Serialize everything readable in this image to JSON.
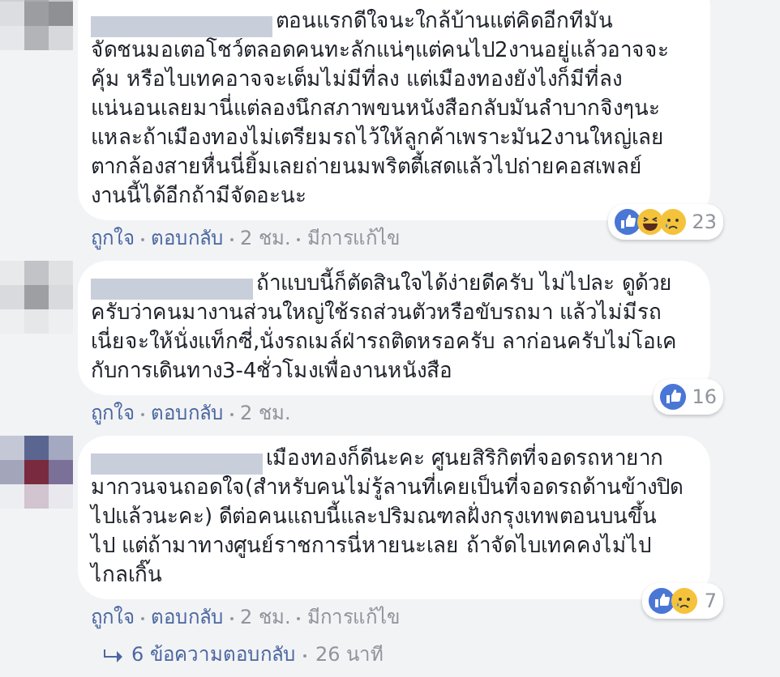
{
  "comments": [
    {
      "text": "ตอนแรกดีใจนะใกล้บ้านแต่คิดอีกทีมัน\nจัดชนมอเตอโชว์ตลอดคนทะลักแน่ๆแต่คนไป2งานอยู่แล้วอาจจะ\nคุ้ม หรือไบเทคอาจจะเต็มไม่มีที่ลง แต่เมืองทองยังไงก็มีที่ลง\nแน่นอนเลยมานี่แต่ลองนึกสภาพขนหนังสือกลับมันลำบากจิงๆนะ\nแหละถ้าเมืองทองไม่เตรียมรถไว้ให้ลูกค้าเพราะมัน2งานใหญ่เลย\nตากล้องสายหื่นนี่ยิ้มเลยถ่ายนมพริตตี้เสดแล้วไปถ่ายคอสเพลย์\nงานนี้ได้อีกถ้ามีจัดอะนะ",
      "reactions": [
        {
          "kind": "like"
        },
        {
          "kind": "haha"
        },
        {
          "kind": "sad"
        }
      ],
      "count": "23",
      "meta": [
        {
          "text": "ถูกใจ",
          "kind": "link"
        },
        {
          "text": "ตอบกลับ",
          "kind": "link"
        },
        {
          "text": "2 ชม.",
          "kind": "plain"
        },
        {
          "text": "มีการแก้ไข",
          "kind": "plain"
        }
      ]
    },
    {
      "text": "ถ้าแบบนี้ก็ตัดสินใจได้ง่ายดีครับ ไม่ไปละ ดูด้วย\nครับว่าคนมางานส่วนใหญ่ใช้รถส่วนตัวหรือขับรถมา แล้วไม่มีรถ\nเนี่ยจะให้นั่งแท็กซี่,นั่งรถเมล์ฝ่ารถติดหรอครับ ลาก่อนครับไม่โอเค\nกับการเดินทาง3-4ชั่วโมงเพื่องานหนังสือ",
      "reactions": [
        {
          "kind": "like"
        }
      ],
      "count": "16",
      "meta": [
        {
          "text": "ถูกใจ",
          "kind": "link"
        },
        {
          "text": "ตอบกลับ",
          "kind": "link"
        },
        {
          "text": "2 ชม.",
          "kind": "plain"
        }
      ]
    },
    {
      "text": "เมืองทองก็ดีนะคะ ศูนยสิริกิตที่จอดรถหายาก\nมากวนจนถอดใจ(สำหรับคนไม่รู้ลานที่เคยเป็นที่จอดรถด้านข้างปิด\nไปแล้วนะคะ) ดีต่อคนแถบนี้และปริมณฑลฝั่งกรุงเทพตอนบนขึ้น\nไป แต่ถ้ามาทางศูนย์ราชการนี่หายนะเลย ถ้าจัดไบเทคคงไม่ไป\nไกลเกิ๊น",
      "reactions": [
        {
          "kind": "like"
        },
        {
          "kind": "sad"
        }
      ],
      "count": "7",
      "meta": [
        {
          "text": "ถูกใจ",
          "kind": "link"
        },
        {
          "text": "ตอบกลับ",
          "kind": "link"
        },
        {
          "text": "2 ชม.",
          "kind": "plain"
        },
        {
          "text": "มีการแก้ไข",
          "kind": "plain"
        }
      ]
    }
  ],
  "replies": {
    "text": "6 ข้อความตอบกลับ",
    "time": "26 นาที"
  }
}
